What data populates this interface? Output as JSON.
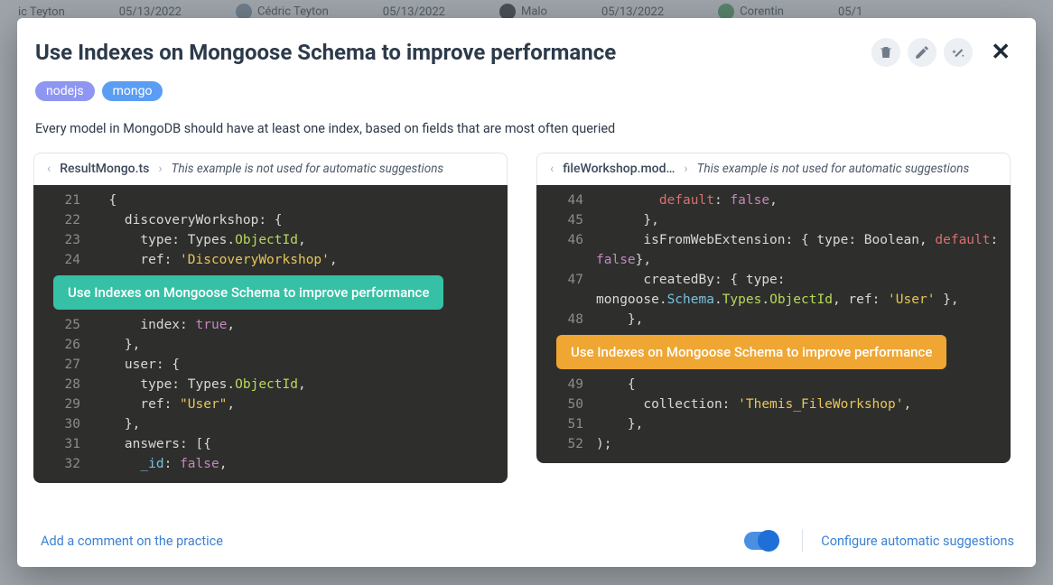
{
  "background": {
    "users": [
      {
        "name": "ic Teyton",
        "date": "05/13/2022"
      },
      {
        "name": "Cédric Teyton",
        "date": "05/13/2022"
      },
      {
        "name": "Malo",
        "date": "05/13/2022"
      },
      {
        "name": "Corentin",
        "date": "05/1"
      }
    ]
  },
  "modal": {
    "title": "Use Indexes on Mongoose Schema to improve performance",
    "tags": [
      {
        "label": "nodejs",
        "class": "nodejs"
      },
      {
        "label": "mongo",
        "class": "mongo"
      }
    ],
    "description": "Every model in MongoDB should have at least one index, based on fields that are most often queried",
    "panes": {
      "left": {
        "filename": "ResultMongo.ts",
        "note": "This example is not used for automatic suggestions",
        "suggestion": "Use Indexes on Mongoose Schema to improve performance",
        "code_before": [
          {
            "n": 21,
            "tokens": [
              {
                "t": "  {",
                "c": ""
              }
            ]
          },
          {
            "n": 22,
            "tokens": [
              {
                "t": "    discoveryWorkshop: {",
                "c": ""
              }
            ]
          },
          {
            "n": 23,
            "tokens": [
              {
                "t": "      type: Types.",
                "c": ""
              },
              {
                "t": "ObjectId",
                "c": "k-obj"
              },
              {
                "t": ",",
                "c": ""
              }
            ]
          },
          {
            "n": 24,
            "tokens": [
              {
                "t": "      ref: ",
                "c": ""
              },
              {
                "t": "'DiscoveryWorkshop'",
                "c": "k-str"
              },
              {
                "t": ",",
                "c": ""
              }
            ]
          }
        ],
        "code_after": [
          {
            "n": 25,
            "tokens": [
              {
                "t": "      index: ",
                "c": ""
              },
              {
                "t": "true",
                "c": "k-bool"
              },
              {
                "t": ",",
                "c": ""
              }
            ]
          },
          {
            "n": 26,
            "tokens": [
              {
                "t": "    },",
                "c": ""
              }
            ]
          },
          {
            "n": 27,
            "tokens": [
              {
                "t": "    user: {",
                "c": ""
              }
            ]
          },
          {
            "n": 28,
            "tokens": [
              {
                "t": "      type: Types.",
                "c": ""
              },
              {
                "t": "ObjectId",
                "c": "k-obj"
              },
              {
                "t": ",",
                "c": ""
              }
            ]
          },
          {
            "n": 29,
            "tokens": [
              {
                "t": "      ref: ",
                "c": ""
              },
              {
                "t": "\"User\"",
                "c": "k-str"
              },
              {
                "t": ",",
                "c": ""
              }
            ]
          },
          {
            "n": 30,
            "tokens": [
              {
                "t": "    },",
                "c": ""
              }
            ]
          },
          {
            "n": 31,
            "tokens": [
              {
                "t": "    answers: [{",
                "c": ""
              }
            ]
          },
          {
            "n": 32,
            "tokens": [
              {
                "t": "      ",
                "c": ""
              },
              {
                "t": "_id",
                "c": "k-type"
              },
              {
                "t": ": ",
                "c": ""
              },
              {
                "t": "false",
                "c": "k-bool"
              },
              {
                "t": ",",
                "c": ""
              }
            ]
          }
        ]
      },
      "right": {
        "filename": "fileWorkshop.mod…",
        "note": "This example is not used for automatic suggestions",
        "suggestion": "Use Indexes on Mongoose Schema to improve performance",
        "code_before": [
          {
            "n": 44,
            "tokens": [
              {
                "t": "        ",
                "c": ""
              },
              {
                "t": "default",
                "c": "k-def"
              },
              {
                "t": ": ",
                "c": ""
              },
              {
                "t": "false",
                "c": "k-bool"
              },
              {
                "t": ",",
                "c": ""
              }
            ]
          },
          {
            "n": 45,
            "tokens": [
              {
                "t": "      },",
                "c": ""
              }
            ]
          },
          {
            "n": 46,
            "tokens": [
              {
                "t": "      isFromWebExtension: { type: Boolean, ",
                "c": ""
              },
              {
                "t": "default",
                "c": "k-def"
              },
              {
                "t": ": ",
                "c": ""
              }
            ]
          },
          {
            "n": "",
            "tokens": [
              {
                "t": "false",
                "c": "k-bool"
              },
              {
                "t": "},",
                "c": ""
              }
            ],
            "wrap": true
          },
          {
            "n": 47,
            "tokens": [
              {
                "t": "      createdBy: { type: ",
                "c": ""
              }
            ]
          },
          {
            "n": "",
            "tokens": [
              {
                "t": "mongoose.",
                "c": ""
              },
              {
                "t": "Schema",
                "c": "k-type"
              },
              {
                "t": ".",
                "c": ""
              },
              {
                "t": "Types",
                "c": "k-obj"
              },
              {
                "t": ".",
                "c": ""
              },
              {
                "t": "ObjectId",
                "c": "k-obj"
              },
              {
                "t": ", ref: ",
                "c": ""
              },
              {
                "t": "'User'",
                "c": "k-str"
              },
              {
                "t": " },",
                "c": ""
              }
            ],
            "wrap": true
          },
          {
            "n": 48,
            "tokens": [
              {
                "t": "    },",
                "c": ""
              }
            ]
          }
        ],
        "code_after": [
          {
            "n": 49,
            "tokens": [
              {
                "t": "    {",
                "c": ""
              }
            ]
          },
          {
            "n": 50,
            "tokens": [
              {
                "t": "      collection: ",
                "c": ""
              },
              {
                "t": "'Themis_FileWorkshop'",
                "c": "k-str"
              },
              {
                "t": ",",
                "c": ""
              }
            ]
          },
          {
            "n": 51,
            "tokens": [
              {
                "t": "    },",
                "c": ""
              }
            ]
          },
          {
            "n": 52,
            "tokens": [
              {
                "t": ");",
                "c": ""
              }
            ]
          }
        ]
      }
    },
    "footer": {
      "comment_prompt": "Add a comment on the practice",
      "toggle_on": true,
      "config_link": "Configure automatic suggestions"
    },
    "icons": {
      "trash": "trash-icon",
      "edit": "pencil-icon",
      "wand": "wand-icon",
      "close": "close-icon"
    }
  }
}
